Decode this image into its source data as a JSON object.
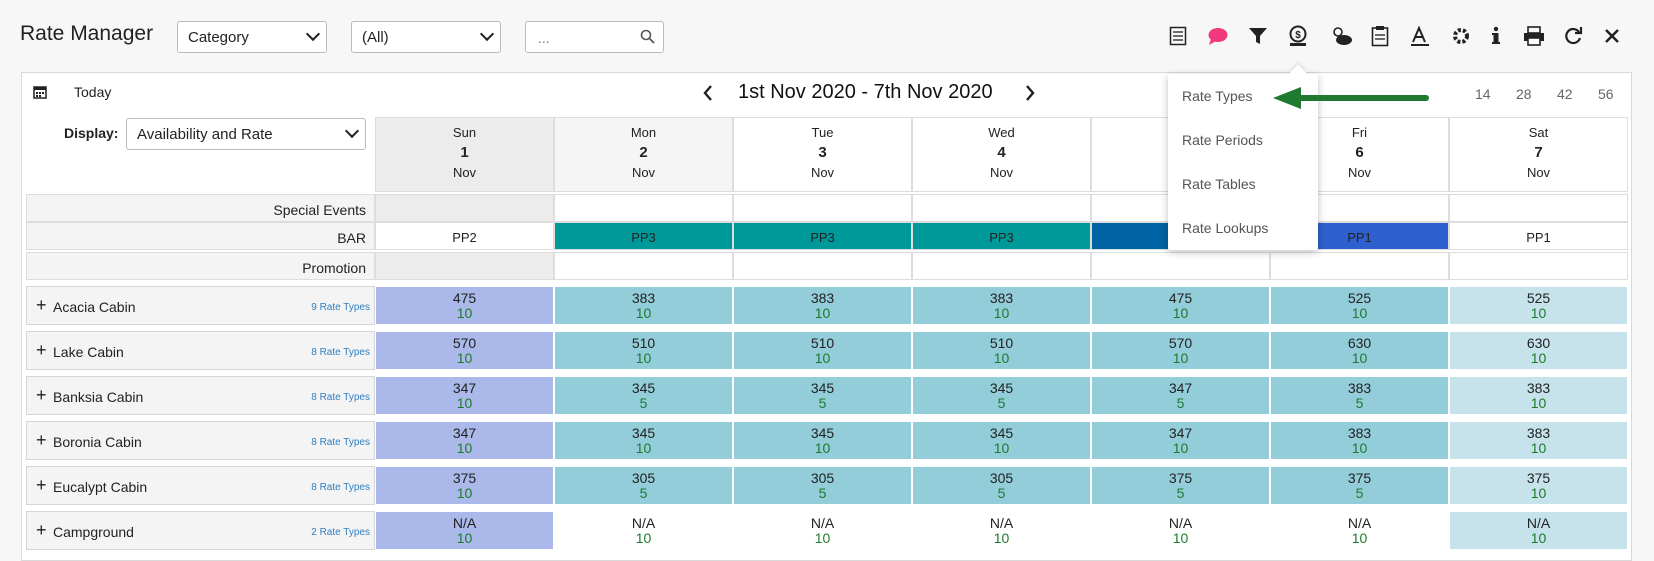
{
  "app_title": "Rate Manager",
  "filters": {
    "category": "Category",
    "all": "(All)",
    "search_placeholder": "..."
  },
  "toolbar_icons": [
    "list-icon",
    "chat-icon",
    "filter-icon",
    "rate-icon",
    "weather-icon",
    "clipboard-icon",
    "text-icon",
    "gear-icon",
    "info-icon",
    "print-icon",
    "refresh-icon",
    "close-icon"
  ],
  "calendar": {
    "today_label": "Today",
    "range": "1st Nov 2020 - 7th Nov 2020",
    "span_options": [
      "14",
      "28",
      "42",
      "56"
    ],
    "display_label": "Display:",
    "display_value": "Availability and Rate"
  },
  "days": [
    {
      "weekday": "Sun",
      "day": "1",
      "month": "Nov"
    },
    {
      "weekday": "Mon",
      "day": "2",
      "month": "Nov"
    },
    {
      "weekday": "Tue",
      "day": "3",
      "month": "Nov"
    },
    {
      "weekday": "Wed",
      "day": "4",
      "month": "Nov"
    },
    {
      "weekday": "",
      "day": "",
      "month": ""
    },
    {
      "weekday": "Fri",
      "day": "6",
      "month": "Nov"
    },
    {
      "weekday": "Sat",
      "day": "7",
      "month": "Nov"
    }
  ],
  "info_rows": {
    "special_events": "Special Events",
    "bar": "BAR",
    "promotion": "Promotion",
    "bar_values": [
      "PP2",
      "PP3",
      "PP3",
      "PP3",
      "",
      "PP1",
      "PP1"
    ]
  },
  "rooms": [
    {
      "name": "Acacia Cabin",
      "rate_types": "9 Rate Types",
      "rates": [
        "475",
        "383",
        "383",
        "383",
        "475",
        "525",
        "525"
      ],
      "avail": [
        "10",
        "10",
        "10",
        "10",
        "10",
        "10",
        "10"
      ]
    },
    {
      "name": "Lake Cabin",
      "rate_types": "8 Rate Types",
      "rates": [
        "570",
        "510",
        "510",
        "510",
        "570",
        "630",
        "630"
      ],
      "avail": [
        "10",
        "10",
        "10",
        "10",
        "10",
        "10",
        "10"
      ]
    },
    {
      "name": "Banksia Cabin",
      "rate_types": "8 Rate Types",
      "rates": [
        "347",
        "345",
        "345",
        "345",
        "347",
        "383",
        "383"
      ],
      "avail": [
        "10",
        "5",
        "5",
        "5",
        "5",
        "5",
        "10"
      ]
    },
    {
      "name": "Boronia Cabin",
      "rate_types": "8 Rate Types",
      "rates": [
        "347",
        "345",
        "345",
        "345",
        "347",
        "383",
        "383"
      ],
      "avail": [
        "10",
        "10",
        "10",
        "10",
        "10",
        "10",
        "10"
      ]
    },
    {
      "name": "Eucalypt Cabin",
      "rate_types": "8 Rate Types",
      "rates": [
        "375",
        "305",
        "305",
        "305",
        "375",
        "375",
        "375"
      ],
      "avail": [
        "10",
        "5",
        "5",
        "5",
        "5",
        "5",
        "10"
      ]
    },
    {
      "name": "Campground",
      "rate_types": "2 Rate Types",
      "rates": [
        "N/A",
        "N/A",
        "N/A",
        "N/A",
        "N/A",
        "N/A",
        "N/A"
      ],
      "avail": [
        "10",
        "10",
        "10",
        "10",
        "10",
        "10",
        "10"
      ]
    }
  ],
  "dropdown": {
    "items": [
      "Rate Types",
      "Rate Periods",
      "Rate Tables",
      "Rate Lookups"
    ]
  },
  "colors": {
    "sun": "#aab8ea",
    "teal": "#92cdd9",
    "teal_dark": "#00999a",
    "sat": "#c6e2ea",
    "bar_blue": "#2d5fce",
    "bar_darkblue": "#0063a3",
    "arrow": "#1e7a2e"
  }
}
